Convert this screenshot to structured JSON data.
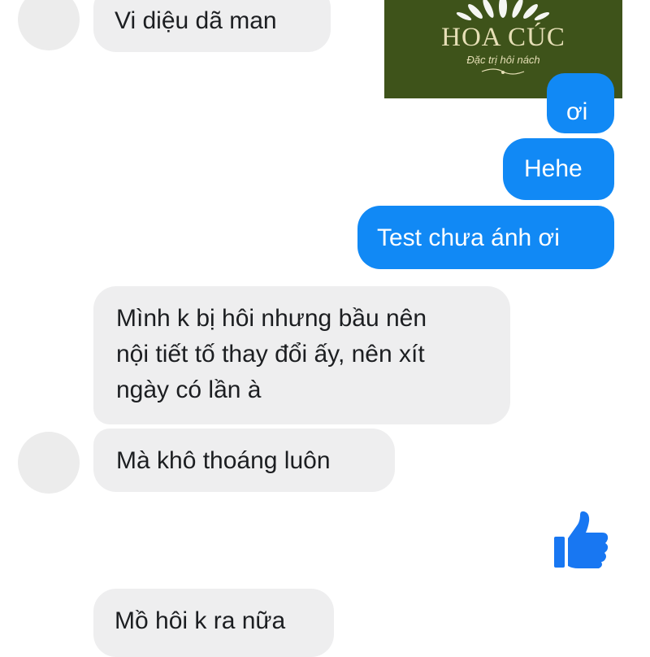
{
  "brand": {
    "name": "HOA CÚC",
    "tagline": "Đặc trị hôi nách",
    "colors": {
      "background": "#3e531a",
      "text": "#e6dfb6"
    }
  },
  "messages": [
    {
      "direction": "incoming",
      "text": "Vi diệu dã man"
    },
    {
      "direction": "outgoing",
      "text": "ơi"
    },
    {
      "direction": "outgoing",
      "text": "Hehe"
    },
    {
      "direction": "outgoing",
      "text": "Test chưa ánh ơi"
    },
    {
      "direction": "incoming",
      "text": "Mình k bị hôi nhưng bầu nên\nnội tiết tố thay đổi ấy, nên xít\nngày có lần à"
    },
    {
      "direction": "incoming",
      "text": "Mà khô thoáng luôn"
    },
    {
      "direction": "outgoing",
      "reaction": "thumbs-up-icon"
    },
    {
      "direction": "incoming",
      "text": "Mồ hôi k ra nữa"
    }
  ],
  "colors": {
    "outgoing_bubble": "#1189f5",
    "incoming_bubble": "#eeeeef",
    "like_icon": "#1877f2"
  }
}
